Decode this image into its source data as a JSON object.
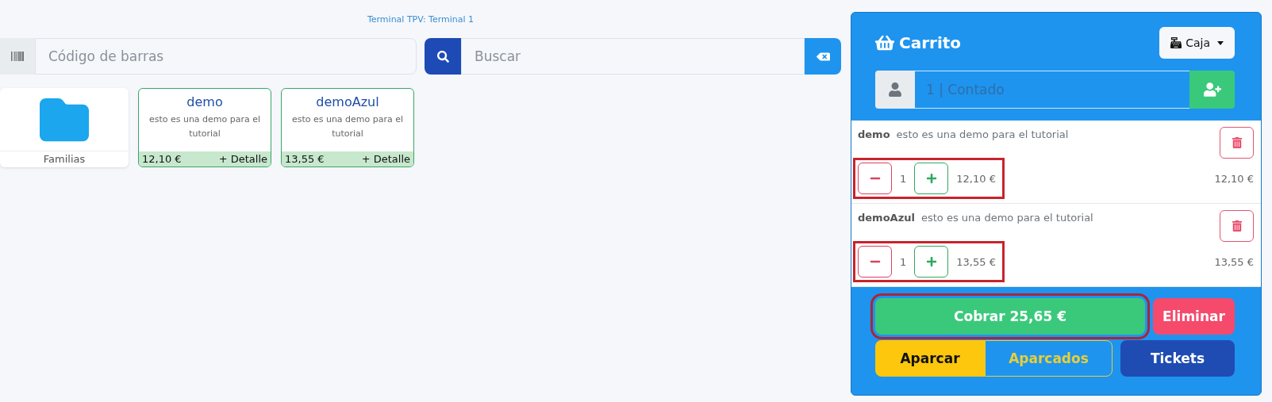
{
  "terminal_label": "Terminal TPV: Terminal 1",
  "barcode_field": {
    "placeholder": "Código de barras"
  },
  "search_field": {
    "placeholder": "Buscar"
  },
  "tiles": [
    {
      "kind": "folder",
      "label": "Familias"
    },
    {
      "kind": "product",
      "name": "demo",
      "description": "esto es una demo para el tutorial",
      "price": "12,10 €",
      "detail": "+ Detalle"
    },
    {
      "kind": "product",
      "name": "demoAzul",
      "description": "esto es una demo para el tutorial",
      "price": "13,55 €",
      "detail": "+ Detalle"
    }
  ],
  "cart": {
    "title": "Carrito",
    "register_button": "Caja",
    "customer_field": {
      "placeholder": "1 | Contado"
    },
    "items": [
      {
        "name": "demo",
        "description": "esto es una demo para el tutorial",
        "quantity": "1",
        "unit_price": "12,10 €",
        "total": "12,10 €",
        "highlighted": true
      },
      {
        "name": "demoAzul",
        "description": "esto es una demo para el tutorial",
        "quantity": "1",
        "unit_price": "13,55 €",
        "total": "13,55 €",
        "highlighted": true
      }
    ],
    "checkout_button": {
      "label": "Cobrar 25,65 €",
      "highlighted": true
    },
    "delete_button": "Eliminar",
    "park_button": "Aparcar",
    "parked_button": "Aparcados",
    "tickets_button": "Tickets"
  }
}
